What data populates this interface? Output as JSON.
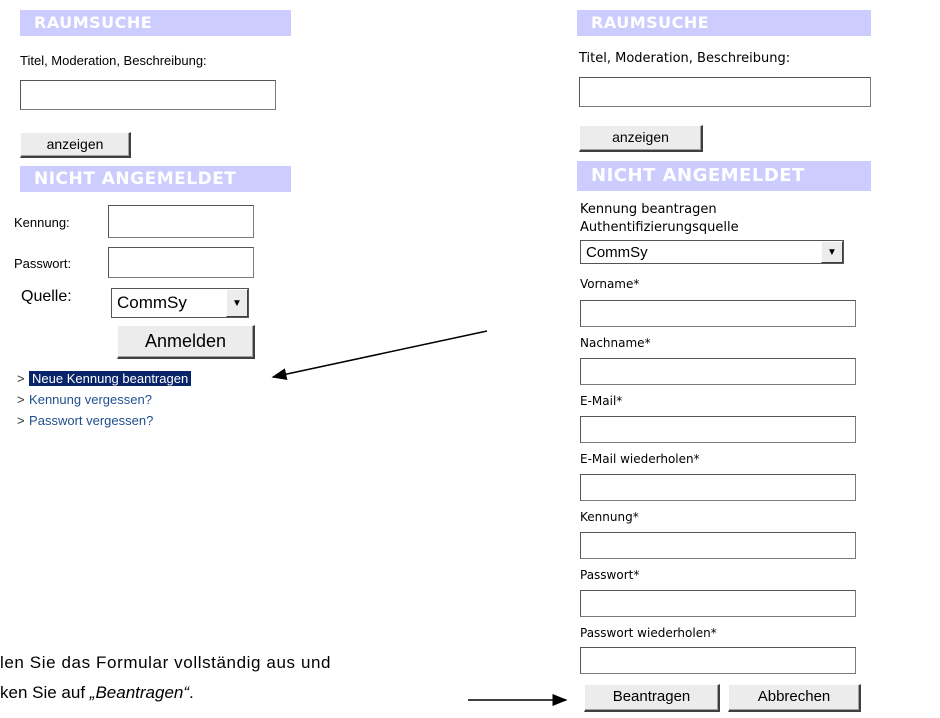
{
  "left_panel": {
    "room_search_header": "RAUMSUCHE",
    "room_search_label": "Titel, Moderation, Beschreibung:",
    "room_search_value": "",
    "show_button": "anzeigen",
    "login_header": "NICHT ANGEMELDET",
    "user_id_label": "Kennung:",
    "user_id_value": "",
    "password_label": "Passwort:",
    "password_value": "",
    "source_label": "Quelle:",
    "source_selected": "CommSy",
    "login_button": "Anmelden",
    "link_prefix": ">",
    "links": [
      "Neue Kennung beantragen",
      "Kennung vergessen?",
      "Passwort vergessen?"
    ]
  },
  "right_panel": {
    "room_search_header": "RAUMSUCHE",
    "room_search_label": "Titel, Moderation, Beschreibung:",
    "room_search_value": "",
    "show_button": "anzeigen",
    "login_header": "NICHT ANGEMELDET",
    "form_title": "Kennung beantragen",
    "auth_source_label": "Authentifizierungsquelle",
    "auth_source_selected": "CommSy",
    "fields": [
      {
        "label": "Vorname*",
        "value": ""
      },
      {
        "label": "Nachname*",
        "value": ""
      },
      {
        "label": "E-Mail*",
        "value": ""
      },
      {
        "label": "E-Mail wiederholen*",
        "value": ""
      },
      {
        "label": "Kennung*",
        "value": ""
      },
      {
        "label": "Passwort*",
        "value": ""
      },
      {
        "label": "Passwort wiederholen*",
        "value": ""
      }
    ],
    "submit_button": "Beantragen",
    "cancel_button": "Abbrechen"
  },
  "instruction": {
    "line1": "len Sie das Formular vollständig aus und",
    "line2_prefix": "ken Sie auf ",
    "line2_emphasis": "„Beantragen“",
    "line2_suffix": "."
  },
  "icons": {
    "dropdown": "chevron-down-icon",
    "arrow": "arrow-icon"
  },
  "colors": {
    "header_bg": "#ccccff",
    "header_text": "#ffffff",
    "link": "#1f4f8f",
    "highlight_bg": "#0a246a"
  }
}
